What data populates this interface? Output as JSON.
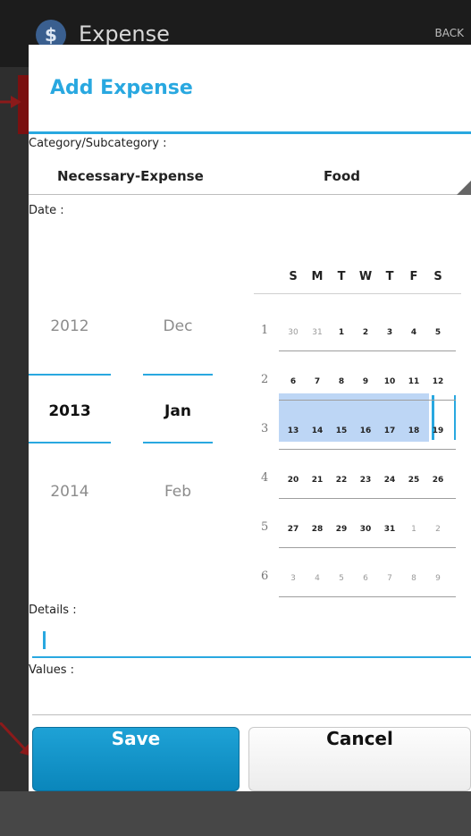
{
  "background_app": {
    "logo_text": "$",
    "title": "Expense",
    "back_label": "BACK"
  },
  "dialog": {
    "title": "Add Expense",
    "category_label": "Category/Subcategory :",
    "category_value": "Necessary-Expense",
    "subcategory_value": "Food",
    "date_label": "Date :",
    "details_label": "Details :",
    "details_value": "",
    "values_label": "Values :",
    "save_label": "Save",
    "cancel_label": "Cancel"
  },
  "date_picker": {
    "years": [
      "2012",
      "2013",
      "2014"
    ],
    "selected_year": "2013",
    "months": [
      "Dec",
      "Jan",
      "Feb"
    ],
    "selected_month": "Jan"
  },
  "calendar": {
    "weekday_headers": [
      "S",
      "M",
      "T",
      "W",
      "T",
      "F",
      "S"
    ],
    "selected_week": 2,
    "selected_day": "12",
    "weeks": [
      {
        "number": "1",
        "days": [
          "30",
          "31",
          "1",
          "2",
          "3",
          "4",
          "5"
        ],
        "other": [
          true,
          true,
          false,
          false,
          false,
          false,
          false
        ]
      },
      {
        "number": "2",
        "days": [
          "6",
          "7",
          "8",
          "9",
          "10",
          "11",
          "12"
        ],
        "other": [
          false,
          false,
          false,
          false,
          false,
          false,
          false
        ]
      },
      {
        "number": "3",
        "days": [
          "13",
          "14",
          "15",
          "16",
          "17",
          "18",
          "19"
        ],
        "other": [
          false,
          false,
          false,
          false,
          false,
          false,
          false
        ]
      },
      {
        "number": "4",
        "days": [
          "20",
          "21",
          "22",
          "23",
          "24",
          "25",
          "26"
        ],
        "other": [
          false,
          false,
          false,
          false,
          false,
          false,
          false
        ]
      },
      {
        "number": "5",
        "days": [
          "27",
          "28",
          "29",
          "30",
          "31",
          "1",
          "2"
        ],
        "other": [
          false,
          false,
          false,
          false,
          false,
          true,
          true
        ]
      },
      {
        "number": "6",
        "days": [
          "3",
          "4",
          "5",
          "6",
          "7",
          "8",
          "9"
        ],
        "other": [
          true,
          true,
          true,
          true,
          true,
          true,
          true
        ]
      }
    ]
  },
  "colors": {
    "accent": "#29a8e0",
    "week_highlight": "#bdd6f5",
    "annotation_arrow": "#8b1a1a",
    "save_button": "#0a86bb"
  }
}
